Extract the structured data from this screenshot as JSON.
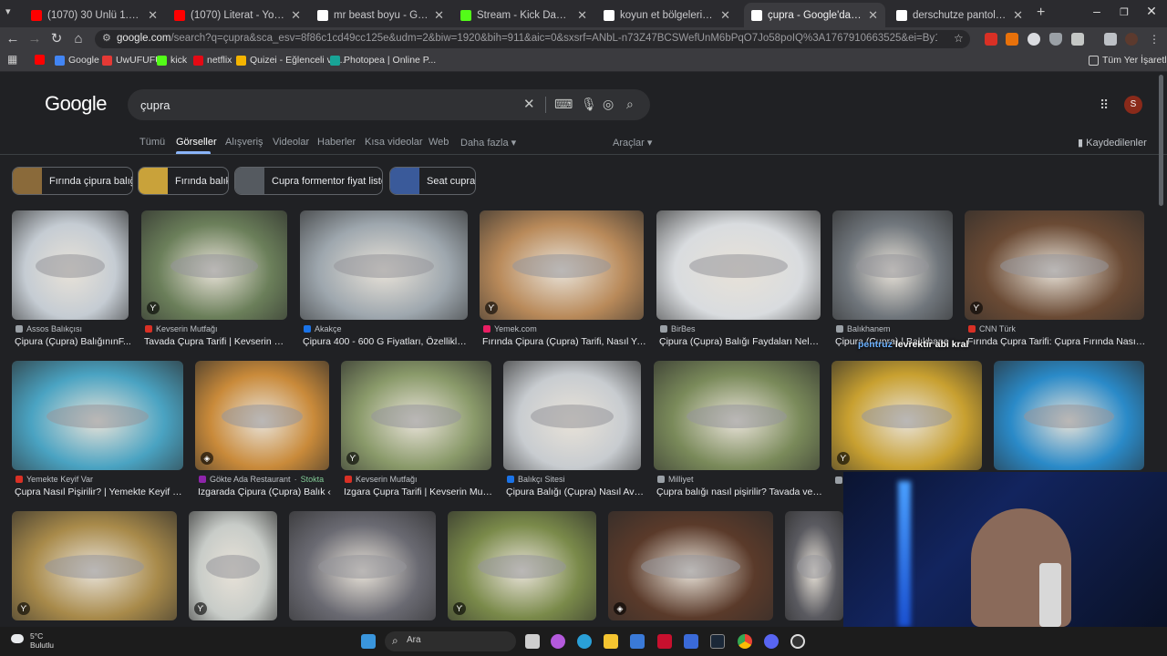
{
  "browser": {
    "tabs": [
      {
        "title": "(1070) 30 Ünlü 1.000.000 Dolar",
        "favicon_color": "#ff0000"
      },
      {
        "title": "(1070) Literat - YouTube",
        "favicon_color": "#ff0000"
      },
      {
        "title": "mr beast boyu - Google'da Ara",
        "favicon_color": "#ffffff"
      },
      {
        "title": "Stream - Kick Dashboard",
        "favicon_color": "#53fc18"
      },
      {
        "title": "koyun et bölgeleri - Google'da",
        "favicon_color": "#ffffff"
      },
      {
        "title": "çupra - Google'da Ara",
        "favicon_color": "#ffffff",
        "active": true
      },
      {
        "title": "derschutze pantolon - Google",
        "favicon_color": "#ffffff"
      }
    ],
    "url_main": "google.com",
    "url_rest": "/search?q=çupra&sca_esv=8f86c1cd49cc125e&udm=2&biw=1920&bih=911&aic=0&sxsrf=ANbL-n73Z47BCSWefUnM6bPqO7Jo58poIQ%3A1767910663525&ei=By1gacDmH-uywPAPp4XYsQI&ved=0ahUKE...",
    "bookmarks": [
      {
        "label": "",
        "icon": "youtube-icon",
        "color": "#ff0000"
      },
      {
        "label": "Google",
        "icon": "google-icon",
        "color": "#4285f4"
      },
      {
        "label": "UwUFUFU",
        "icon": "uwufufu-icon",
        "color": "#e53935"
      },
      {
        "label": "kick",
        "icon": "kick-icon",
        "color": "#53fc18"
      },
      {
        "label": "netflix",
        "icon": "netflix-icon",
        "color": "#e50914"
      },
      {
        "label": "Quizei - Eğlenceli ve...",
        "icon": "quizei-icon",
        "color": "#f4b400"
      },
      {
        "label": "Photopea | Online P...",
        "icon": "photopea-icon",
        "color": "#18a497"
      }
    ],
    "all_bookmarks": "Tüm Yer İşaretleri"
  },
  "google": {
    "logo": "Google",
    "query": "çupra",
    "nav": [
      "Tümü",
      "Görseller",
      "Alışveriş",
      "Videolar",
      "Haberler",
      "Kısa videolar",
      "Web",
      "Daha fazla"
    ],
    "tools": "Araçlar",
    "saved": "Kaydedilenler",
    "avatar": "S",
    "chips": [
      {
        "label": "Fırında çipura balığı",
        "color": "#8a6a3a"
      },
      {
        "label": "Fırında balık",
        "color": "#c9a23a"
      },
      {
        "label": "Cupra formentor fiyat listesi",
        "color": "#555a60"
      },
      {
        "label": "Seat cupra",
        "color": "#3a5a9a"
      }
    ]
  },
  "results": [
    [
      {
        "source": "Assos Balıkçısı",
        "caption": "Çipura (Çupra) BalığınınF...",
        "color": "#c5ccd3",
        "src_color": "#9aa0a6"
      },
      {
        "source": "Kevserin Mutfağı",
        "caption": "Tavada Çupra Tarifi | Kevserin Mut...",
        "color": "#6b7f5a",
        "src_color": "#d93025",
        "badge": "ϒ"
      },
      {
        "source": "Akakçe",
        "caption": "Çipura 400 - 600 G Fiyatları, Özellikleri...",
        "color": "#9ea7ae",
        "src_color": "#1a73e8"
      },
      {
        "source": "Yemek.com",
        "caption": "Fırında Çipura (Çupra) Tarifi, Nasıl Ya...",
        "color": "#b98a5a",
        "src_color": "#e91e63",
        "badge": "ϒ"
      },
      {
        "source": "BirBes",
        "caption": "Çipura (Çupra) Balığı Faydaları Nelerd...",
        "color": "#d9dcdf",
        "src_color": "#9aa0a6"
      },
      {
        "source": "Balıkhanem",
        "caption": "Çipura (Çupra) | Balıkhane",
        "color": "#70767c",
        "src_color": "#9aa0a6"
      },
      {
        "source": "CNN Türk",
        "caption": "Fırında Çupra Tarifi: Çupra Fırında Nasıl Y...",
        "color": "#6a4a34",
        "src_color": "#d93025",
        "badge": "ϒ"
      }
    ],
    [
      {
        "source": "Yemekte Keyif Var",
        "caption": "Çupra Nasıl Pişirilir? | Yemekte Keyif Var",
        "color": "#4aa3c2",
        "src_color": "#d93025"
      },
      {
        "source": "Gökte Ada Restaurant",
        "stock": "Stokta",
        "caption": "Izgarada Çipura (Çupra) Balık ‹",
        "color": "#c98a3a",
        "src_color": "#8e24aa",
        "badge": "◈"
      },
      {
        "source": "Kevserin Mutfağı",
        "caption": "Izgara Çupra Tarifi | Kevserin Mutf...",
        "color": "#8a9a6a",
        "src_color": "#d93025",
        "badge": "ϒ"
      },
      {
        "source": "Balıkçı Sitesi",
        "caption": "Çipura Balığı (Çupra) Nasıl Avl...",
        "color": "#c8ccd0",
        "src_color": "#1a73e8"
      },
      {
        "source": "Milliyet",
        "caption": "Çupra balığı nasıl pişirilir? Tavada ve ı...",
        "color": "#7a8a5a",
        "src_color": "#9aa0a6"
      },
      {
        "source": "",
        "caption": "",
        "color": "#c8a030",
        "src_color": "#9aa0a6",
        "badge": "ϒ"
      },
      {
        "source": "",
        "caption": "Fı",
        "color": "#2a8ac8",
        "src_color": "#f4a300"
      }
    ],
    [
      {
        "color": "#a88a4a",
        "badge": "ϒ"
      },
      {
        "color": "#c8ccc8",
        "badge": "ϒ"
      },
      {
        "color": "#6a6a72"
      },
      {
        "color": "#7a8a4a",
        "badge": "ϒ"
      },
      {
        "color": "#5a3a2a",
        "badge": "◈"
      },
      {
        "color": "#5a5a60"
      }
    ]
  ],
  "overlay_text": "levrektir abi kral",
  "overlay_user": "pentruz",
  "taskbar": {
    "temp": "5°C",
    "condition": "Bulutlu",
    "search": "Ara"
  }
}
